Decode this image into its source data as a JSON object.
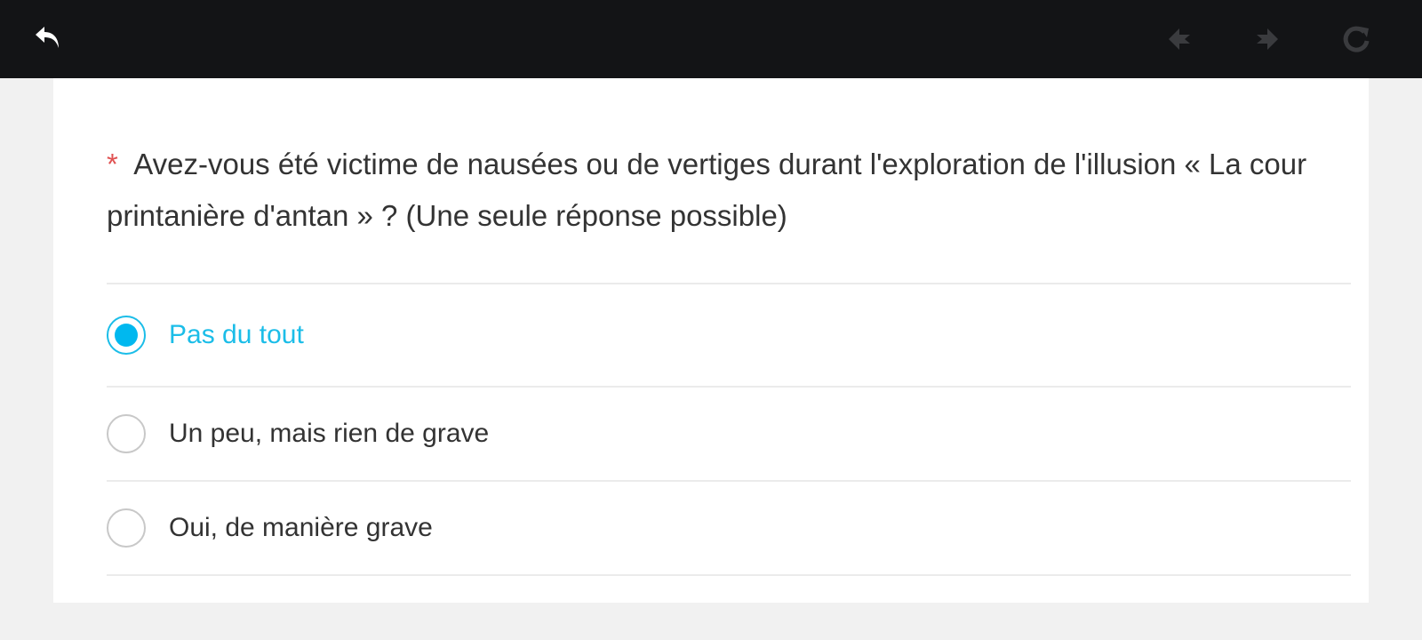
{
  "toolbar": {
    "back_icon": "back-arrow-icon",
    "prev_icon": "previous-arrow-icon",
    "next_icon": "next-arrow-icon",
    "reload_icon": "reload-icon"
  },
  "question": {
    "required_mark": "*",
    "text": "Avez-vous été victime de nausées ou de vertiges durant l'exploration de l'illusion « La cour printanière d'antan » ?  (Une seule réponse possible)"
  },
  "options": [
    {
      "label": "Pas du tout",
      "selected": true
    },
    {
      "label": "Un peu, mais rien de grave",
      "selected": false
    },
    {
      "label": "Oui, de manière grave",
      "selected": false
    }
  ],
  "colors": {
    "topbar": "#131416",
    "accent": "#00b8ef",
    "required": "#e05252",
    "disabled_icon": "#3a3b3e"
  }
}
